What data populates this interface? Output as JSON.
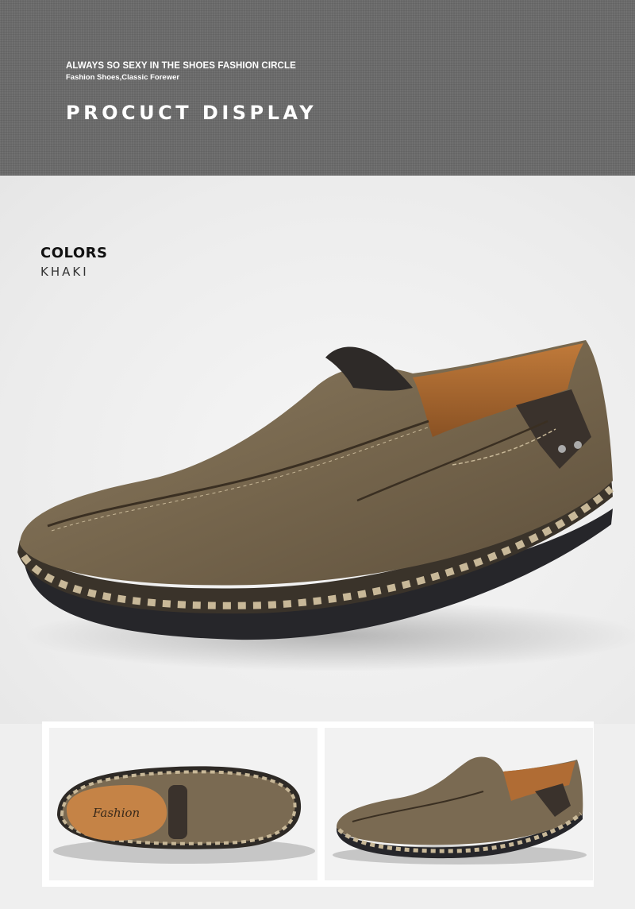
{
  "banner": {
    "tagline": "ALWAYS SO SEXY IN THE SHOES FASHION CIRCLE",
    "subtagline": "Fashion Shoes,Classic Forewer",
    "title": "PROCUCT DISPLAY"
  },
  "colors": {
    "heading": "COLORS",
    "value": "KHAKI"
  },
  "product": {
    "insole_text": "Fashion",
    "leather_color": "#7a6a52",
    "sole_color": "#2a2a2e",
    "stitch_color": "#c8b898"
  }
}
